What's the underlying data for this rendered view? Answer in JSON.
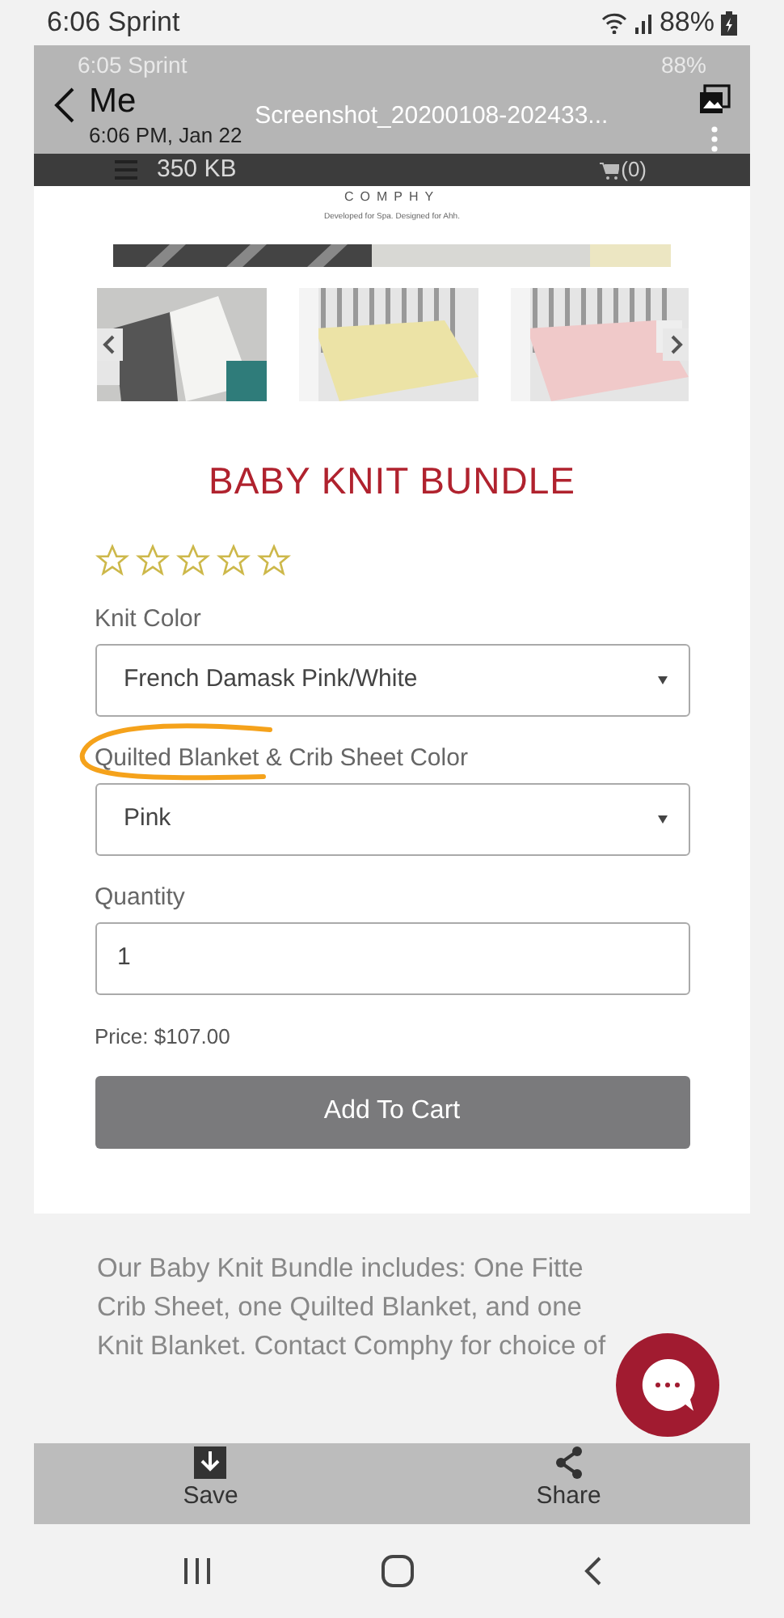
{
  "status_bar": {
    "time_carrier": "6:06 Sprint",
    "battery": "88%"
  },
  "screenshot": {
    "status_bar": {
      "time_carrier": "6:05 Sprint",
      "battery": "88%"
    },
    "viewer_header": {
      "sender": "Me",
      "timestamp": "6:06 PM, Jan 22",
      "file_name": "Screenshot_20200108-202433...",
      "file_size": "350 KB"
    },
    "site_header": {
      "cart": "(0)",
      "logo": "COMPHY",
      "tagline": "Developed for Spa. Designed for Ahh."
    },
    "product": {
      "title": "BABY KNIT BUNDLE",
      "stars": 0,
      "fields": [
        {
          "kind": "select",
          "label": "Knit Color",
          "value": "French Damask Pink/White"
        },
        {
          "kind": "select",
          "label": "Quilted Blanket & Crib Sheet Color",
          "value": "Pink"
        },
        {
          "kind": "input",
          "label": "Quantity",
          "value": "1"
        }
      ],
      "price": "Price: $107.00",
      "button": "Add To Cart"
    },
    "description": [
      "Our Baby Knit Bundle includes: One Fitte",
      "Crib Sheet, one Quilted Blanket, and one",
      "Knit Blanket. Contact Comphy for choice of"
    ],
    "actions": [
      {
        "kind": "save",
        "label": "Save"
      },
      {
        "kind": "share",
        "label": "Share"
      }
    ]
  }
}
